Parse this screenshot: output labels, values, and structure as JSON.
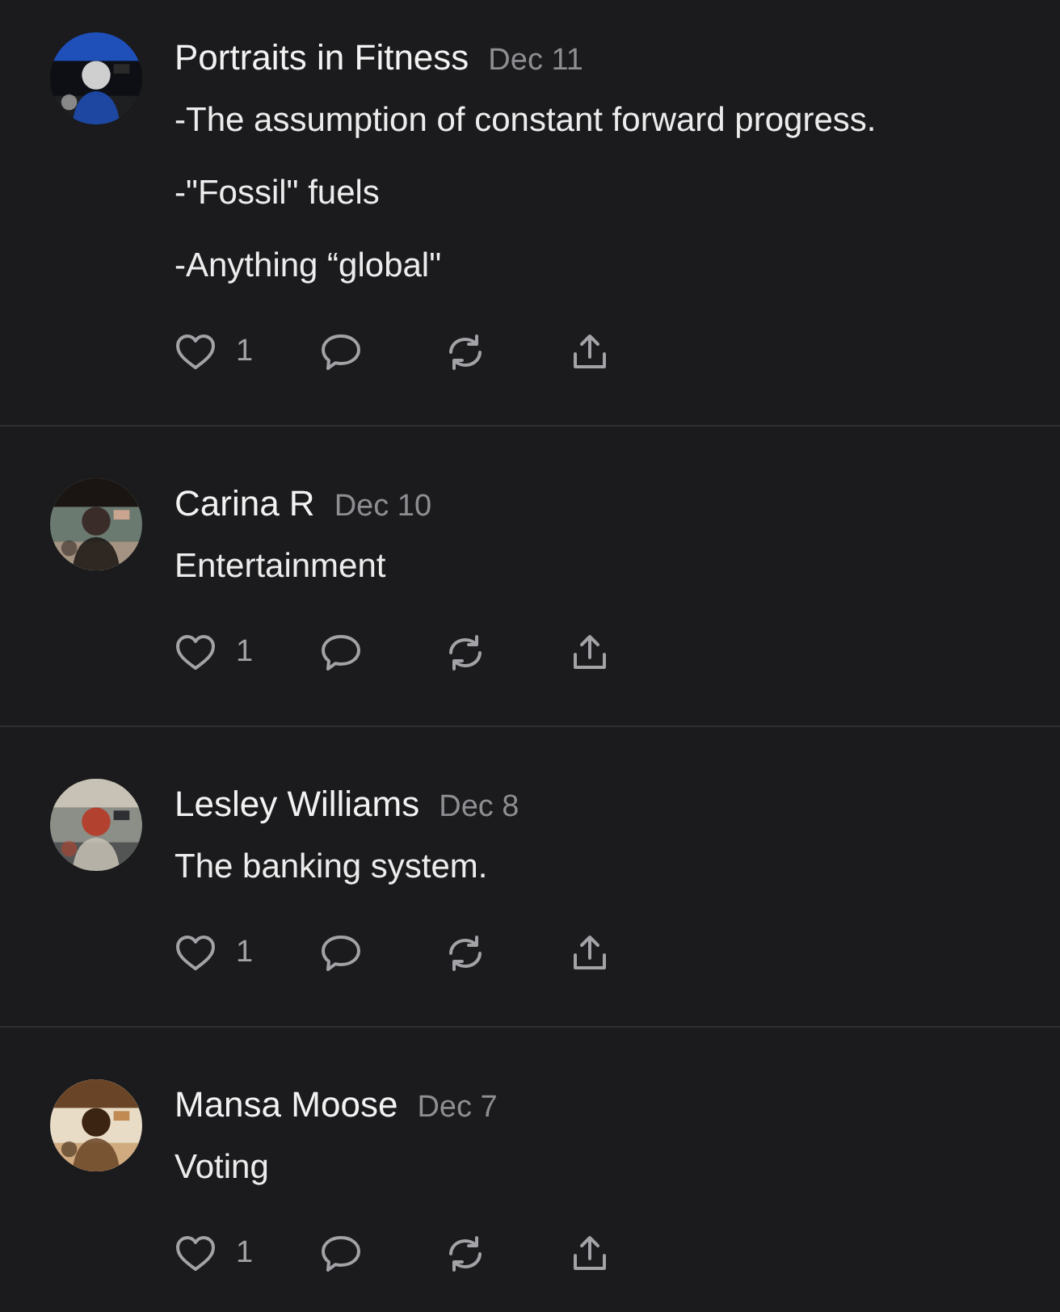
{
  "comments": [
    {
      "author": "Portraits in Fitness",
      "date": "Dec 11",
      "paragraphs": [
        "-The assumption of constant forward progress.",
        "-\"Fossil\" fuels",
        "-Anything “global\""
      ],
      "likes": "1"
    },
    {
      "author": "Carina R",
      "date": "Dec 10",
      "paragraphs": [
        "Entertainment"
      ],
      "likes": "1"
    },
    {
      "author": "Lesley Williams",
      "date": "Dec 8",
      "paragraphs": [
        "The banking system."
      ],
      "likes": "1"
    },
    {
      "author": "Mansa Moose",
      "date": "Dec 7",
      "paragraphs": [
        "Voting"
      ],
      "likes": "1"
    }
  ]
}
